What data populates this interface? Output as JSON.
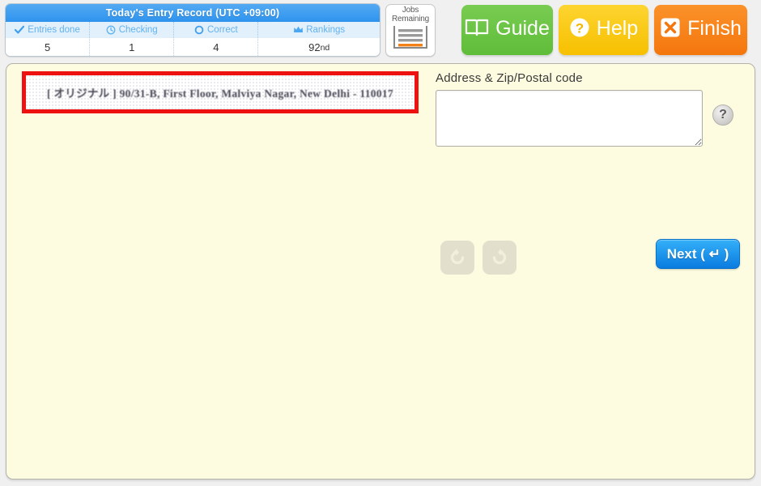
{
  "entry_record": {
    "title": "Today's Entry Record (UTC +09:00)",
    "columns": [
      {
        "label": "Entries done",
        "icon": "check-icon",
        "value": "5",
        "suffix": ""
      },
      {
        "label": "Checking",
        "icon": "clock-icon",
        "value": "1",
        "suffix": ""
      },
      {
        "label": "Correct",
        "icon": "circle-icon",
        "value": "4",
        "suffix": ""
      },
      {
        "label": "Rankings",
        "icon": "crown-icon",
        "value": "92",
        "suffix": "nd"
      }
    ]
  },
  "jobs_remaining": {
    "label_line1": "Jobs",
    "label_line2": "Remaining",
    "icon": "list-lines-icon"
  },
  "actions": {
    "guide": {
      "label": "Guide",
      "icon": "book-icon",
      "color": "#6cc545"
    },
    "help": {
      "label": "Help",
      "icon": "question-circle-icon",
      "color": "#f8c800"
    },
    "finish": {
      "label": "Finish",
      "icon": "x-square-icon",
      "color": "#f7801a"
    }
  },
  "task": {
    "scan_text": "[ オリジナル ] 90/31-B, First Floor, Malviya Nagar, New Delhi - 110017",
    "highlight_color": "#ee1111"
  },
  "form": {
    "field_label": "Address & Zip/Postal code",
    "address_value": "",
    "address_placeholder": "",
    "help_hint": "?"
  },
  "history": {
    "undo": {
      "icon": "undo-arrow-icon"
    },
    "redo": {
      "icon": "redo-arrow-icon"
    }
  },
  "next": {
    "label": "Next ( ↵ )"
  }
}
